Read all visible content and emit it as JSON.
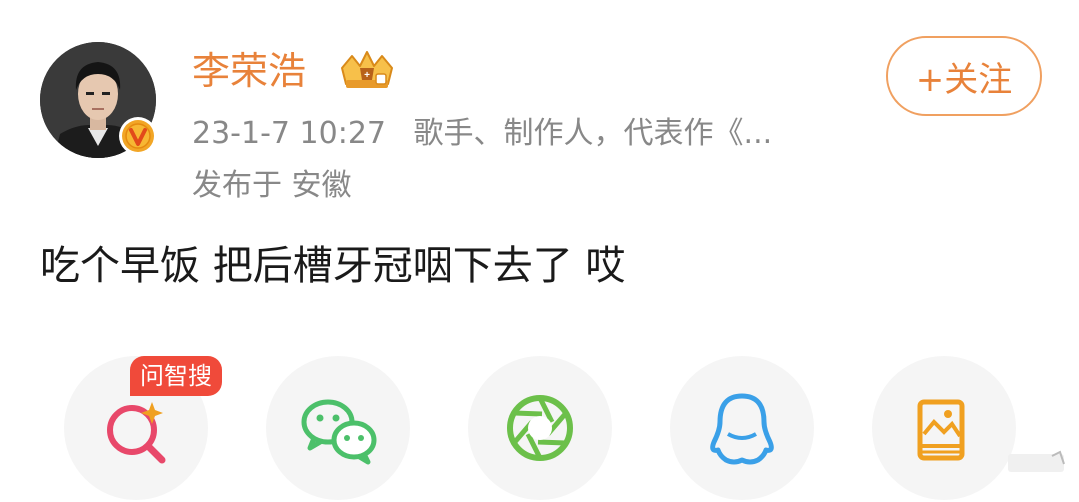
{
  "post": {
    "author": {
      "name": "李荣浩",
      "avatar_icon": "user-avatar",
      "verified_icon": "verified-v-badge-icon",
      "crown_icon": "crown-icon"
    },
    "follow_label": "+关注",
    "time": "23-1-7 10:27",
    "description": "歌手、制作人，代表作《...",
    "location": "发布于 安徽",
    "text": "吃个早饭 把后槽牙冠咽下去了 哎"
  },
  "share": {
    "badge": "问智搜",
    "items": [
      {
        "icon": "search-ai-icon",
        "color": "#e8486a"
      },
      {
        "icon": "wechat-icon",
        "color": "#4cc06a"
      },
      {
        "icon": "moments-icon",
        "color": "#6cc04a"
      },
      {
        "icon": "qq-icon",
        "color": "#3aa0e8"
      },
      {
        "icon": "album-icon",
        "color": "#f0a020"
      }
    ]
  },
  "colors": {
    "accent": "#e8823a",
    "meta_text": "#888888",
    "badge_red": "#f04a3a"
  }
}
